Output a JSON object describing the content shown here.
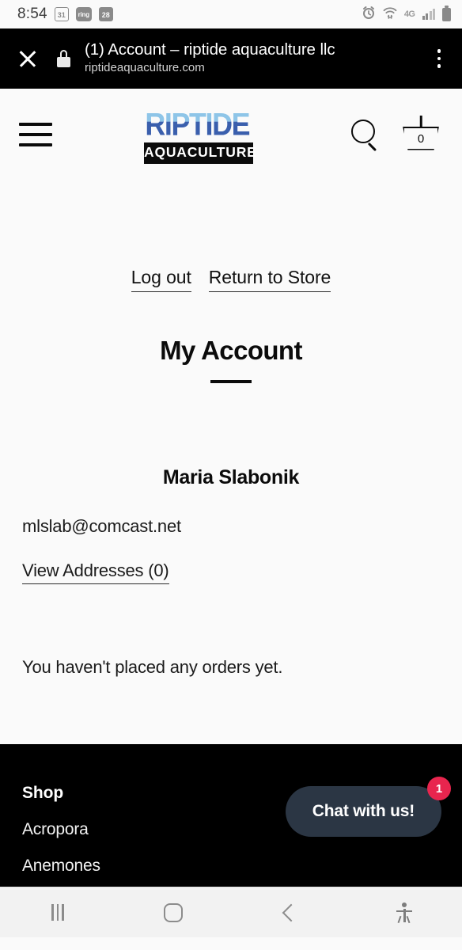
{
  "status_bar": {
    "time": "8:54",
    "calendar_day": "31",
    "ring_app": "ring",
    "calendar_day_2": "28",
    "network_type": "4G",
    "icons": [
      "calendar-icon",
      "ring-icon",
      "calendar-icon",
      "alarm-icon",
      "wifi-icon",
      "signal-icon",
      "battery-icon"
    ]
  },
  "browser": {
    "title": "(1) Account – riptide aquaculture llc",
    "url": "riptideaquaculture.com",
    "close_label": "Close",
    "menu_label": "More options"
  },
  "site_header": {
    "menu_label": "Menu",
    "logo_word": "RIPTIDE",
    "logo_sub": "AQUACULTURE",
    "search_label": "Search",
    "cart_count": "0"
  },
  "account": {
    "log_out": "Log out",
    "return_to_store": "Return to Store",
    "title": "My Account",
    "customer_name": "Maria Slabonik",
    "email": "mlslab@comcast.net",
    "view_addresses": "View Addresses (0)",
    "orders_empty": "You haven't placed any orders yet."
  },
  "footer": {
    "heading": "Shop",
    "links": [
      {
        "label": "Acropora"
      },
      {
        "label": "Anemones"
      }
    ],
    "chat_label": "Chat with us!",
    "chat_badge": "1"
  },
  "nav_bar": {
    "recents": "Recents",
    "home": "Home",
    "back": "Back",
    "accessibility": "Accessibility"
  },
  "colors": {
    "page_bg": "#fafafa",
    "footer_bg": "#000000",
    "logo_light_blue": "#8ec5e8",
    "logo_dark_blue": "#3a5fad",
    "chat_bg": "#2b3644",
    "badge_red": "#e8254e"
  }
}
